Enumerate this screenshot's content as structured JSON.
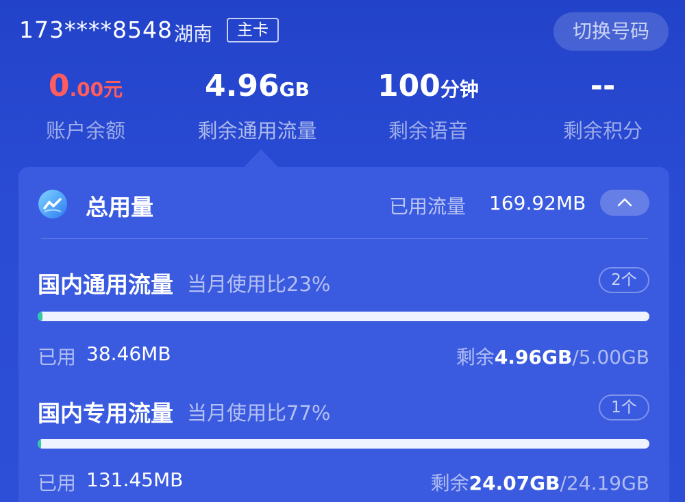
{
  "header": {
    "phone": "173****8548",
    "region": "湖南",
    "card_type": "主卡",
    "switch_label": "切换号码"
  },
  "stats": {
    "balance": {
      "int": "0",
      "dec": ".00",
      "unit": "元",
      "label": "账户余额"
    },
    "data": {
      "value": "4.96",
      "unit": "GB",
      "label": "剩余通用流量"
    },
    "voice": {
      "value": "100",
      "unit": "分钟",
      "label": "剩余语音"
    },
    "points": {
      "value": "--",
      "label": "剩余积分"
    }
  },
  "total": {
    "title": "总用量",
    "used_label": "已用流量",
    "used_value": "169.92MB"
  },
  "items": [
    {
      "name": "国内通用流量",
      "ratio": "当月使用比23%",
      "count": "2个",
      "used_label": "已用",
      "used_value": "38.46MB",
      "remain_label": "剩余",
      "remain_value": "4.96GB",
      "total_value": "/5.00GB",
      "progress": 0.008
    },
    {
      "name": "国内专用流量",
      "ratio": "当月使用比77%",
      "count": "1个",
      "used_label": "已用",
      "used_value": "131.45MB",
      "remain_label": "剩余",
      "remain_value": "24.07GB",
      "total_value": "/24.19GB",
      "progress": 0.005
    }
  ],
  "colors": {
    "background": "#2746cf",
    "panel": "#3a5be0",
    "balance_red": "#ff5d5d",
    "progress_fill": "#2fc9a7",
    "progress_track": "#eef3ff"
  }
}
